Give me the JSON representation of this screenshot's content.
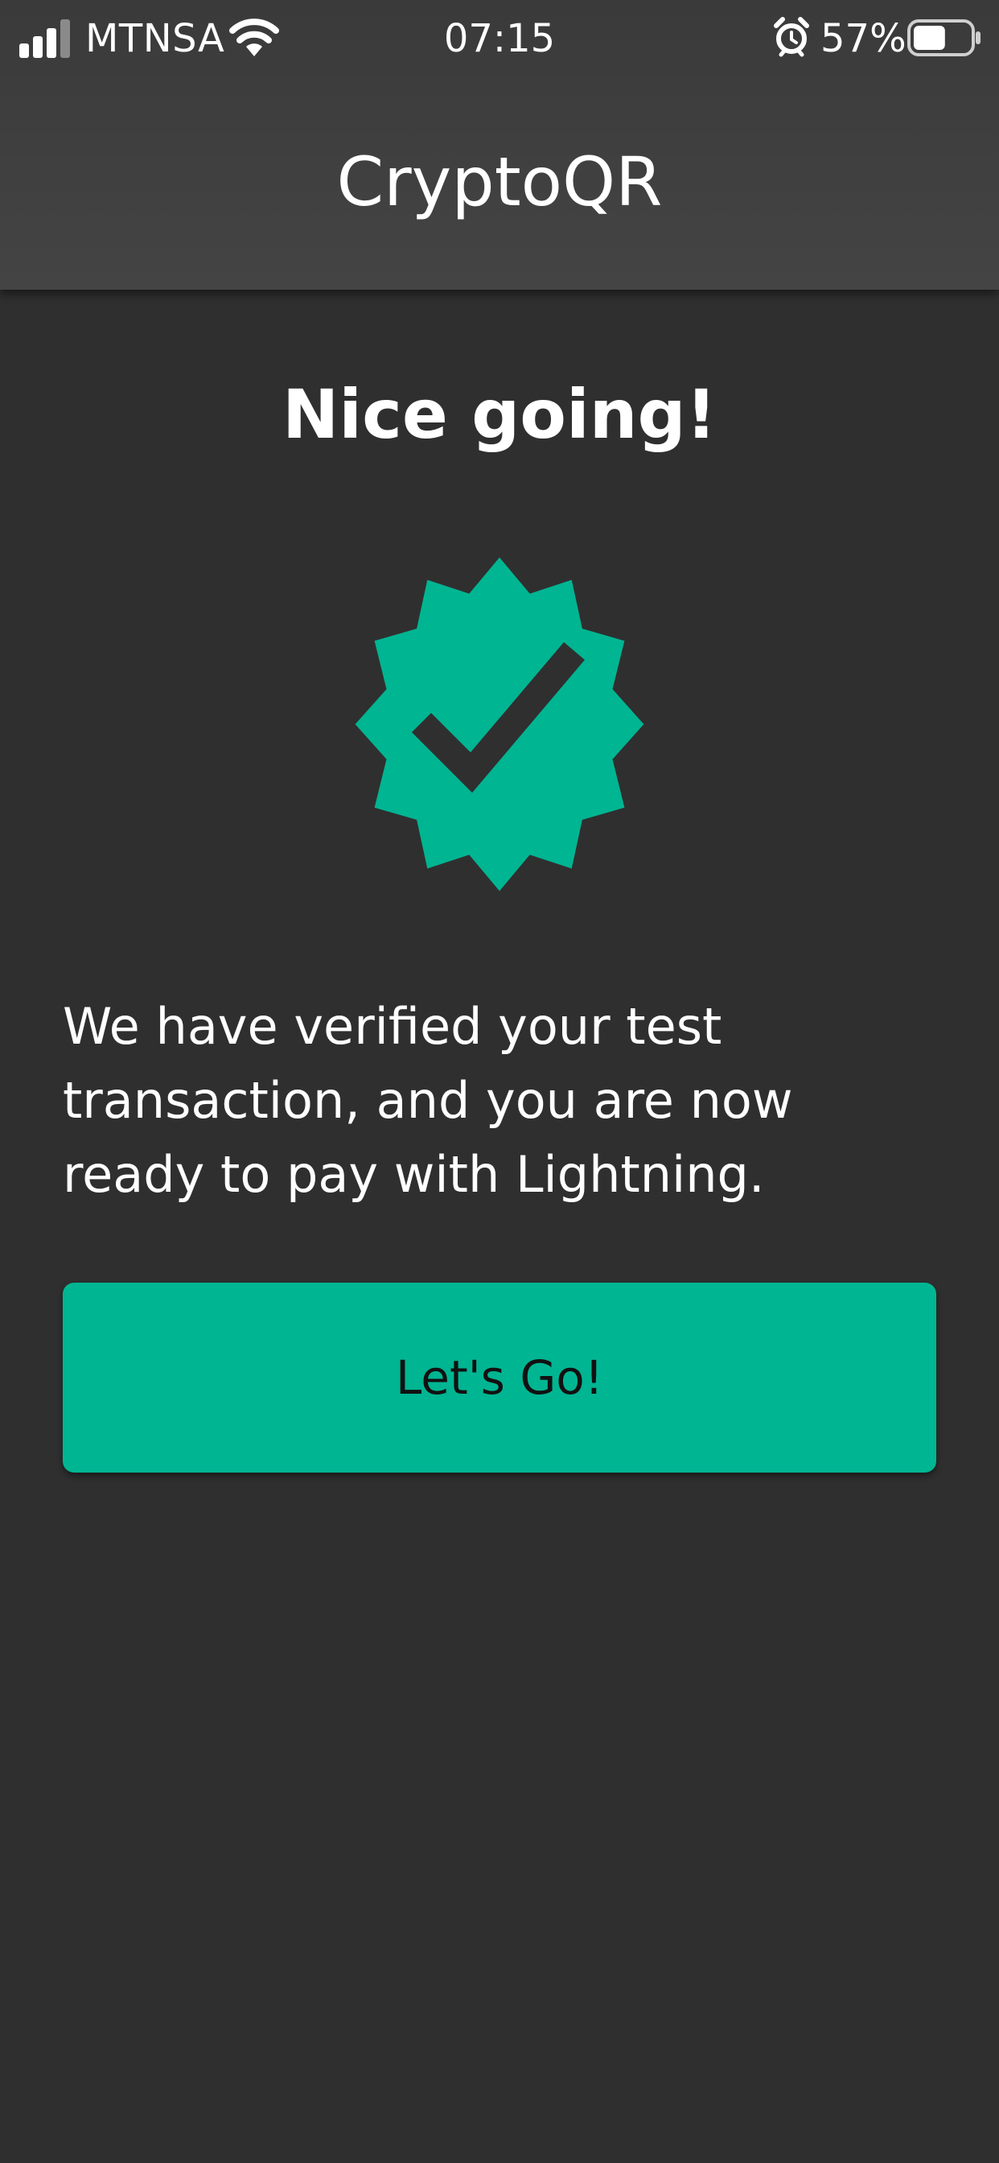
{
  "status_bar": {
    "carrier": "MTNSA",
    "time": "07:15",
    "battery_percent": "57%",
    "battery_level": 0.57,
    "icons": [
      "signal-icon",
      "wifi-icon",
      "alarm-icon",
      "battery-icon"
    ]
  },
  "header": {
    "title": "CryptoQR"
  },
  "main": {
    "headline": "Nice going!",
    "badge_icon": "verified-badge-icon",
    "message": "We have verified your test transaction, and you are now ready to pay with Lightning.",
    "cta_label": "Let's Go!"
  },
  "colors": {
    "background": "#2f2f2f",
    "header": "#404040",
    "accent": "#00b592",
    "text": "#ffffff",
    "button_text": "#111111"
  }
}
